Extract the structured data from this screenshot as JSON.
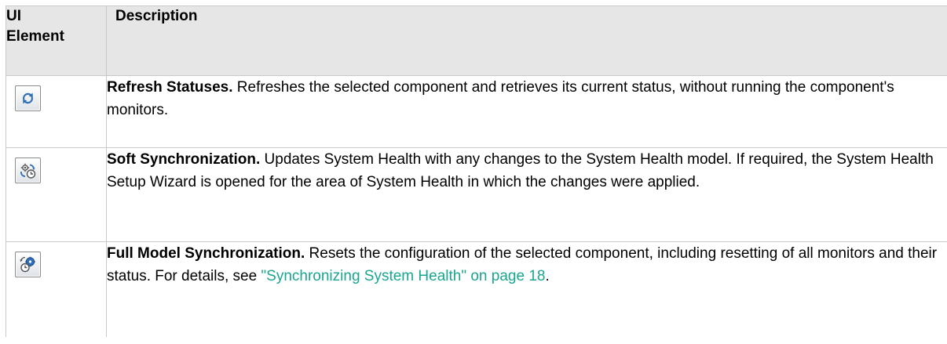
{
  "table": {
    "headers": {
      "ui_element_line1": "UI",
      "ui_element_line2": "Element",
      "description": "Description"
    },
    "rows": [
      {
        "icon": "refresh-statuses-icon",
        "title": "Refresh Statuses.",
        "text": " Refreshes the selected component and retrieves its current status, without running the component's monitors."
      },
      {
        "icon": "soft-synchronization-icon",
        "title": "Soft Synchronization.",
        "text": " Updates System Health with any changes to the System Health model. If required, the System Health Setup Wizard is opened for the area of System Health in which the changes were applied."
      },
      {
        "icon": "full-model-synchronization-icon",
        "title": "Full Model Synchronization.",
        "text": " Resets the configuration of the selected component, including resetting of all monitors and their status. For details, see ",
        "link": "\"Synchronizing System Health\" on page 18",
        "text_after": "."
      }
    ]
  },
  "colors": {
    "header_bg": "#e6e6e6",
    "border": "#c9c9c9",
    "link": "#1aa68e",
    "icon_blue": "#2f6fb5"
  }
}
